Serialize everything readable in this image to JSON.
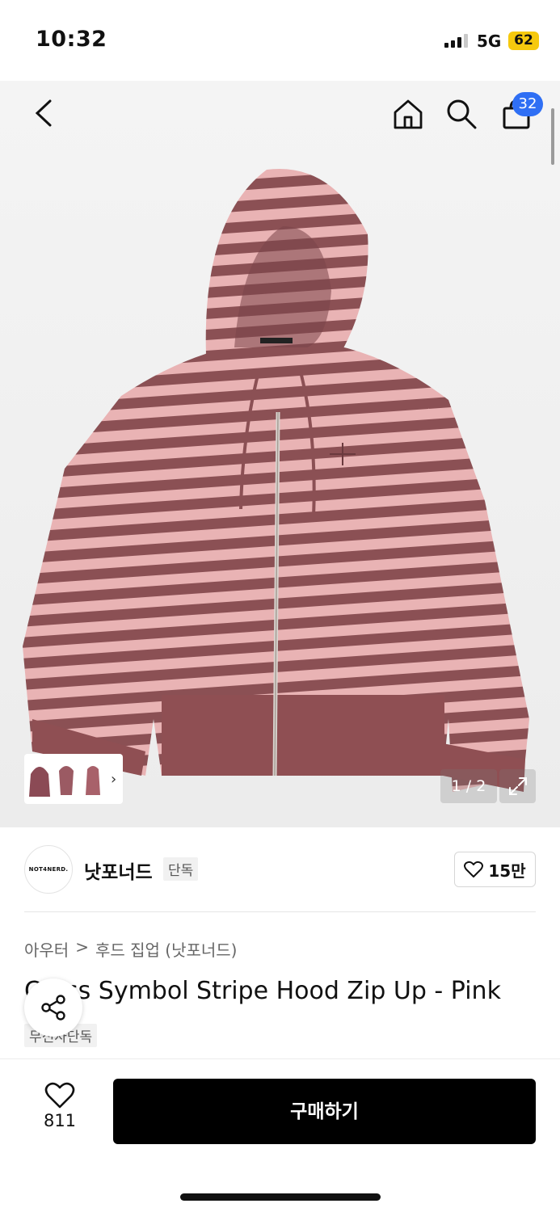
{
  "status_bar": {
    "time": "10:32",
    "network": "5G",
    "battery": "62"
  },
  "nav": {
    "cart_count": "32"
  },
  "gallery": {
    "page_indicator": "1 / 2"
  },
  "brand": {
    "logo_text": "NOT4NERD.",
    "name": "낫포너드",
    "tag": "단독",
    "likes": "15만"
  },
  "breadcrumb": {
    "category": "아우터",
    "separator": ">",
    "subcategory": "후드 집업 (낫포너드)"
  },
  "product": {
    "title": "Cross Symbol Stripe Hood Zip Up - Pink",
    "exclusive_tag": "무신사단독"
  },
  "bottom_bar": {
    "wish_count": "811",
    "buy_label": "구매하기"
  },
  "colors": {
    "accent": "#2f6ff4",
    "buy_button": "#000000",
    "battery": "#f6c90e"
  }
}
